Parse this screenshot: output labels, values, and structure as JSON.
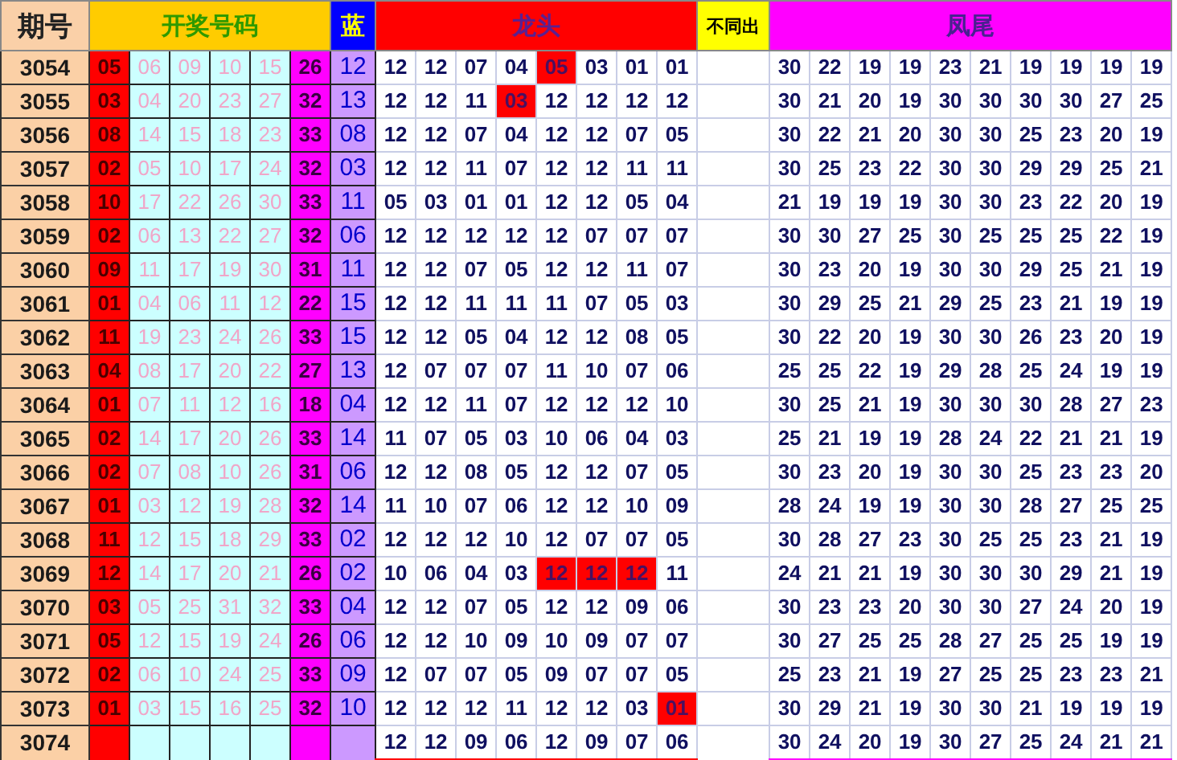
{
  "headers": {
    "issue": "期号",
    "draw": "开奖号码",
    "blue": "蓝",
    "long": "龙头",
    "diff": "不同出",
    "tail": "凤尾"
  },
  "rows": [
    {
      "issue": "3054",
      "draw": [
        "05",
        "06",
        "09",
        "10",
        "15",
        "26"
      ],
      "blue": "12",
      "long": [
        {
          "text": "12",
          "hit": false
        },
        {
          "text": "12",
          "hit": false
        },
        {
          "text": "07",
          "hit": false
        },
        {
          "text": "04",
          "hit": false
        },
        {
          "text": "05",
          "hit": true
        },
        {
          "text": "03",
          "hit": false
        },
        {
          "text": "01",
          "hit": false
        },
        {
          "text": "01",
          "hit": false
        }
      ],
      "tail": [
        "30",
        "22",
        "19",
        "19",
        "23",
        "21",
        "19",
        "19",
        "19",
        "19"
      ]
    },
    {
      "issue": "3055",
      "draw": [
        "03",
        "04",
        "20",
        "23",
        "27",
        "32"
      ],
      "blue": "13",
      "long": [
        {
          "text": "12",
          "hit": false
        },
        {
          "text": "12",
          "hit": false
        },
        {
          "text": "11",
          "hit": false
        },
        {
          "text": "03",
          "hit": true
        },
        {
          "text": "12",
          "hit": false
        },
        {
          "text": "12",
          "hit": false
        },
        {
          "text": "12",
          "hit": false
        },
        {
          "text": "12",
          "hit": false
        }
      ],
      "tail": [
        "30",
        "21",
        "20",
        "19",
        "30",
        "30",
        "30",
        "30",
        "27",
        "25"
      ]
    },
    {
      "issue": "3056",
      "draw": [
        "08",
        "14",
        "15",
        "18",
        "23",
        "33"
      ],
      "blue": "08",
      "long": [
        {
          "text": "12",
          "hit": false
        },
        {
          "text": "12",
          "hit": false
        },
        {
          "text": "07",
          "hit": false
        },
        {
          "text": "04",
          "hit": false
        },
        {
          "text": "12",
          "hit": false
        },
        {
          "text": "12",
          "hit": false
        },
        {
          "text": "07",
          "hit": false
        },
        {
          "text": "05",
          "hit": false
        }
      ],
      "tail": [
        "30",
        "22",
        "21",
        "20",
        "30",
        "30",
        "25",
        "23",
        "20",
        "19"
      ]
    },
    {
      "issue": "3057",
      "draw": [
        "02",
        "05",
        "10",
        "17",
        "24",
        "32"
      ],
      "blue": "03",
      "long": [
        {
          "text": "12",
          "hit": false
        },
        {
          "text": "12",
          "hit": false
        },
        {
          "text": "11",
          "hit": false
        },
        {
          "text": "07",
          "hit": false
        },
        {
          "text": "12",
          "hit": false
        },
        {
          "text": "12",
          "hit": false
        },
        {
          "text": "11",
          "hit": false
        },
        {
          "text": "11",
          "hit": false
        }
      ],
      "tail": [
        "30",
        "25",
        "23",
        "22",
        "30",
        "30",
        "29",
        "29",
        "25",
        "21"
      ]
    },
    {
      "issue": "3058",
      "draw": [
        "10",
        "17",
        "22",
        "26",
        "30",
        "33"
      ],
      "blue": "11",
      "long": [
        {
          "text": "05",
          "hit": false
        },
        {
          "text": "03",
          "hit": false
        },
        {
          "text": "01",
          "hit": false
        },
        {
          "text": "01",
          "hit": false
        },
        {
          "text": "12",
          "hit": false
        },
        {
          "text": "12",
          "hit": false
        },
        {
          "text": "05",
          "hit": false
        },
        {
          "text": "04",
          "hit": false
        }
      ],
      "tail": [
        "21",
        "19",
        "19",
        "19",
        "30",
        "30",
        "23",
        "22",
        "20",
        "19"
      ]
    },
    {
      "issue": "3059",
      "draw": [
        "02",
        "06",
        "13",
        "22",
        "27",
        "32"
      ],
      "blue": "06",
      "long": [
        {
          "text": "12",
          "hit": false
        },
        {
          "text": "12",
          "hit": false
        },
        {
          "text": "12",
          "hit": false
        },
        {
          "text": "12",
          "hit": false
        },
        {
          "text": "12",
          "hit": false
        },
        {
          "text": "07",
          "hit": false
        },
        {
          "text": "07",
          "hit": false
        },
        {
          "text": "07",
          "hit": false
        }
      ],
      "tail": [
        "30",
        "30",
        "27",
        "25",
        "30",
        "25",
        "25",
        "25",
        "22",
        "19"
      ]
    },
    {
      "issue": "3060",
      "draw": [
        "09",
        "11",
        "17",
        "19",
        "30",
        "31"
      ],
      "blue": "11",
      "long": [
        {
          "text": "12",
          "hit": false
        },
        {
          "text": "12",
          "hit": false
        },
        {
          "text": "07",
          "hit": false
        },
        {
          "text": "05",
          "hit": false
        },
        {
          "text": "12",
          "hit": false
        },
        {
          "text": "12",
          "hit": false
        },
        {
          "text": "11",
          "hit": false
        },
        {
          "text": "07",
          "hit": false
        }
      ],
      "tail": [
        "30",
        "23",
        "20",
        "19",
        "30",
        "30",
        "29",
        "25",
        "21",
        "19"
      ]
    },
    {
      "issue": "3061",
      "draw": [
        "01",
        "04",
        "06",
        "11",
        "12",
        "22"
      ],
      "blue": "15",
      "long": [
        {
          "text": "12",
          "hit": false
        },
        {
          "text": "12",
          "hit": false
        },
        {
          "text": "11",
          "hit": false
        },
        {
          "text": "11",
          "hit": false
        },
        {
          "text": "11",
          "hit": false
        },
        {
          "text": "07",
          "hit": false
        },
        {
          "text": "05",
          "hit": false
        },
        {
          "text": "03",
          "hit": false
        }
      ],
      "tail": [
        "30",
        "29",
        "25",
        "21",
        "29",
        "25",
        "23",
        "21",
        "19",
        "19"
      ]
    },
    {
      "issue": "3062",
      "draw": [
        "11",
        "19",
        "23",
        "24",
        "26",
        "33"
      ],
      "blue": "15",
      "long": [
        {
          "text": "12",
          "hit": false
        },
        {
          "text": "12",
          "hit": false
        },
        {
          "text": "05",
          "hit": false
        },
        {
          "text": "04",
          "hit": false
        },
        {
          "text": "12",
          "hit": false
        },
        {
          "text": "12",
          "hit": false
        },
        {
          "text": "08",
          "hit": false
        },
        {
          "text": "05",
          "hit": false
        }
      ],
      "tail": [
        "30",
        "22",
        "20",
        "19",
        "30",
        "30",
        "26",
        "23",
        "20",
        "19"
      ]
    },
    {
      "issue": "3063",
      "draw": [
        "04",
        "08",
        "17",
        "20",
        "22",
        "27"
      ],
      "blue": "13",
      "long": [
        {
          "text": "12",
          "hit": false
        },
        {
          "text": "07",
          "hit": false
        },
        {
          "text": "07",
          "hit": false
        },
        {
          "text": "07",
          "hit": false
        },
        {
          "text": "11",
          "hit": false
        },
        {
          "text": "10",
          "hit": false
        },
        {
          "text": "07",
          "hit": false
        },
        {
          "text": "06",
          "hit": false
        }
      ],
      "tail": [
        "25",
        "25",
        "22",
        "19",
        "29",
        "28",
        "25",
        "24",
        "19",
        "19"
      ]
    },
    {
      "issue": "3064",
      "draw": [
        "01",
        "07",
        "11",
        "12",
        "16",
        "18"
      ],
      "blue": "04",
      "long": [
        {
          "text": "12",
          "hit": false
        },
        {
          "text": "12",
          "hit": false
        },
        {
          "text": "11",
          "hit": false
        },
        {
          "text": "07",
          "hit": false
        },
        {
          "text": "12",
          "hit": false
        },
        {
          "text": "12",
          "hit": false
        },
        {
          "text": "12",
          "hit": false
        },
        {
          "text": "10",
          "hit": false
        }
      ],
      "tail": [
        "30",
        "25",
        "21",
        "19",
        "30",
        "30",
        "30",
        "28",
        "27",
        "23"
      ]
    },
    {
      "issue": "3065",
      "draw": [
        "02",
        "14",
        "17",
        "20",
        "26",
        "33"
      ],
      "blue": "14",
      "long": [
        {
          "text": "11",
          "hit": false
        },
        {
          "text": "07",
          "hit": false
        },
        {
          "text": "05",
          "hit": false
        },
        {
          "text": "03",
          "hit": false
        },
        {
          "text": "10",
          "hit": false
        },
        {
          "text": "06",
          "hit": false
        },
        {
          "text": "04",
          "hit": false
        },
        {
          "text": "03",
          "hit": false
        }
      ],
      "tail": [
        "25",
        "21",
        "19",
        "19",
        "28",
        "24",
        "22",
        "21",
        "21",
        "19"
      ]
    },
    {
      "issue": "3066",
      "draw": [
        "02",
        "07",
        "08",
        "10",
        "26",
        "31"
      ],
      "blue": "06",
      "long": [
        {
          "text": "12",
          "hit": false
        },
        {
          "text": "12",
          "hit": false
        },
        {
          "text": "08",
          "hit": false
        },
        {
          "text": "05",
          "hit": false
        },
        {
          "text": "12",
          "hit": false
        },
        {
          "text": "12",
          "hit": false
        },
        {
          "text": "07",
          "hit": false
        },
        {
          "text": "05",
          "hit": false
        }
      ],
      "tail": [
        "30",
        "23",
        "20",
        "19",
        "30",
        "30",
        "25",
        "23",
        "23",
        "20"
      ]
    },
    {
      "issue": "3067",
      "draw": [
        "01",
        "03",
        "12",
        "19",
        "28",
        "32"
      ],
      "blue": "14",
      "long": [
        {
          "text": "11",
          "hit": false
        },
        {
          "text": "10",
          "hit": false
        },
        {
          "text": "07",
          "hit": false
        },
        {
          "text": "06",
          "hit": false
        },
        {
          "text": "12",
          "hit": false
        },
        {
          "text": "12",
          "hit": false
        },
        {
          "text": "10",
          "hit": false
        },
        {
          "text": "09",
          "hit": false
        }
      ],
      "tail": [
        "28",
        "24",
        "19",
        "19",
        "30",
        "30",
        "28",
        "27",
        "25",
        "25"
      ]
    },
    {
      "issue": "3068",
      "draw": [
        "11",
        "12",
        "15",
        "18",
        "29",
        "33"
      ],
      "blue": "02",
      "long": [
        {
          "text": "12",
          "hit": false
        },
        {
          "text": "12",
          "hit": false
        },
        {
          "text": "12",
          "hit": false
        },
        {
          "text": "10",
          "hit": false
        },
        {
          "text": "12",
          "hit": false
        },
        {
          "text": "07",
          "hit": false
        },
        {
          "text": "07",
          "hit": false
        },
        {
          "text": "05",
          "hit": false
        }
      ],
      "tail": [
        "30",
        "28",
        "27",
        "23",
        "30",
        "25",
        "25",
        "23",
        "21",
        "19"
      ]
    },
    {
      "issue": "3069",
      "draw": [
        "12",
        "14",
        "17",
        "20",
        "21",
        "26"
      ],
      "blue": "02",
      "long": [
        {
          "text": "10",
          "hit": false
        },
        {
          "text": "06",
          "hit": false
        },
        {
          "text": "04",
          "hit": false
        },
        {
          "text": "03",
          "hit": false
        },
        {
          "text": "12",
          "hit": true
        },
        {
          "text": "12",
          "hit": true
        },
        {
          "text": "12",
          "hit": true
        },
        {
          "text": "11",
          "hit": false
        }
      ],
      "tail": [
        "24",
        "21",
        "21",
        "19",
        "30",
        "30",
        "30",
        "29",
        "21",
        "19"
      ]
    },
    {
      "issue": "3070",
      "draw": [
        "03",
        "05",
        "25",
        "31",
        "32",
        "33"
      ],
      "blue": "04",
      "long": [
        {
          "text": "12",
          "hit": false
        },
        {
          "text": "12",
          "hit": false
        },
        {
          "text": "07",
          "hit": false
        },
        {
          "text": "05",
          "hit": false
        },
        {
          "text": "12",
          "hit": false
        },
        {
          "text": "12",
          "hit": false
        },
        {
          "text": "09",
          "hit": false
        },
        {
          "text": "06",
          "hit": false
        }
      ],
      "tail": [
        "30",
        "23",
        "23",
        "20",
        "30",
        "30",
        "27",
        "24",
        "20",
        "19"
      ]
    },
    {
      "issue": "3071",
      "draw": [
        "05",
        "12",
        "15",
        "19",
        "24",
        "26"
      ],
      "blue": "06",
      "long": [
        {
          "text": "12",
          "hit": false
        },
        {
          "text": "12",
          "hit": false
        },
        {
          "text": "10",
          "hit": false
        },
        {
          "text": "09",
          "hit": false
        },
        {
          "text": "10",
          "hit": false
        },
        {
          "text": "09",
          "hit": false
        },
        {
          "text": "07",
          "hit": false
        },
        {
          "text": "07",
          "hit": false
        }
      ],
      "tail": [
        "30",
        "27",
        "25",
        "25",
        "28",
        "27",
        "25",
        "25",
        "19",
        "19"
      ]
    },
    {
      "issue": "3072",
      "draw": [
        "02",
        "06",
        "10",
        "24",
        "25",
        "33"
      ],
      "blue": "09",
      "long": [
        {
          "text": "12",
          "hit": false
        },
        {
          "text": "07",
          "hit": false
        },
        {
          "text": "07",
          "hit": false
        },
        {
          "text": "05",
          "hit": false
        },
        {
          "text": "09",
          "hit": false
        },
        {
          "text": "07",
          "hit": false
        },
        {
          "text": "07",
          "hit": false
        },
        {
          "text": "05",
          "hit": false
        }
      ],
      "tail": [
        "25",
        "23",
        "21",
        "19",
        "27",
        "25",
        "25",
        "23",
        "23",
        "21"
      ]
    },
    {
      "issue": "3073",
      "draw": [
        "01",
        "03",
        "15",
        "16",
        "25",
        "32"
      ],
      "blue": "10",
      "long": [
        {
          "text": "12",
          "hit": false
        },
        {
          "text": "12",
          "hit": false
        },
        {
          "text": "12",
          "hit": false
        },
        {
          "text": "11",
          "hit": false
        },
        {
          "text": "12",
          "hit": false
        },
        {
          "text": "12",
          "hit": false
        },
        {
          "text": "03",
          "hit": false
        },
        {
          "text": "01",
          "hit": true
        }
      ],
      "tail": [
        "30",
        "29",
        "21",
        "19",
        "30",
        "30",
        "21",
        "19",
        "19",
        "19"
      ]
    },
    {
      "issue": "3074",
      "long": [
        {
          "text": "12",
          "hit": false
        },
        {
          "text": "12",
          "hit": false
        },
        {
          "text": "09",
          "hit": false
        },
        {
          "text": "06",
          "hit": false
        },
        {
          "text": "12",
          "hit": false
        },
        {
          "text": "09",
          "hit": false
        },
        {
          "text": "07",
          "hit": false
        },
        {
          "text": "06",
          "hit": false
        }
      ],
      "tail": [
        "30",
        "24",
        "20",
        "19",
        "30",
        "27",
        "25",
        "24",
        "21",
        "21"
      ]
    }
  ]
}
